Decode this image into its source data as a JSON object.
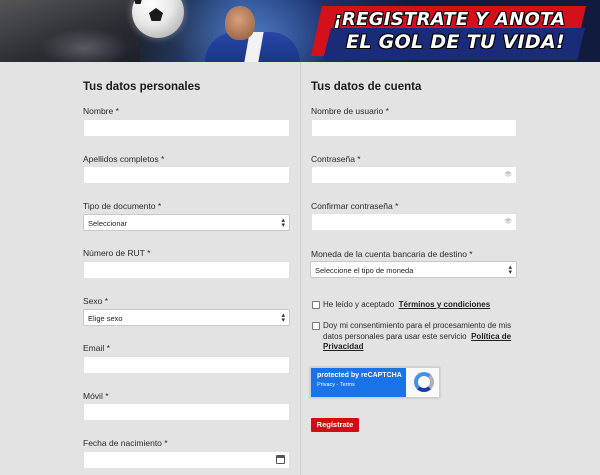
{
  "banner": {
    "line1": "¡REGISTRATE Y ANOTA",
    "line2": "EL GOL DE TU VIDA!"
  },
  "personal": {
    "title": "Tus datos personales",
    "fields": {
      "nombre": "Nombre *",
      "apellidos": "Apellidos completos *",
      "tipo_doc": "Tipo de documento *",
      "tipo_doc_value": "Seleccionar",
      "rut": "Número de RUT *",
      "sexo": "Sexo *",
      "sexo_value": "Elige sexo",
      "email": "Email *",
      "movil": "Móvil *",
      "fecha": "Fecha de nacimiento *"
    }
  },
  "cuenta": {
    "title": "Tus datos de cuenta",
    "fields": {
      "usuario": "Nombre de usuario *",
      "contrasena": "Contraseña *",
      "confirmar": "Confirmar contraseña *",
      "moneda": "Moneda de la cuenta bancaria de destino *",
      "moneda_value": "Seleccione el tipo de moneda"
    },
    "terms_prefix": "He leído y aceptado",
    "terms_link": "Términos y condiciones",
    "consent_text": "Doy mi consentimiento para el procesamiento de mis datos personales para usar este servicio",
    "privacy_link": "Política de Privacidad",
    "recaptcha_title": "protected by reCAPTCHA",
    "recaptcha_links": "Privacy - Terms",
    "submit": "Regístrate"
  },
  "icons": {
    "eye": "eye-icon",
    "calendar": "calendar-icon",
    "select": "chevron-updown-icon"
  },
  "colors": {
    "accent": "#d30b14",
    "banner_red": "#d4101b",
    "banner_blue": "#1a2b7a",
    "background": "#e3e3e3"
  }
}
